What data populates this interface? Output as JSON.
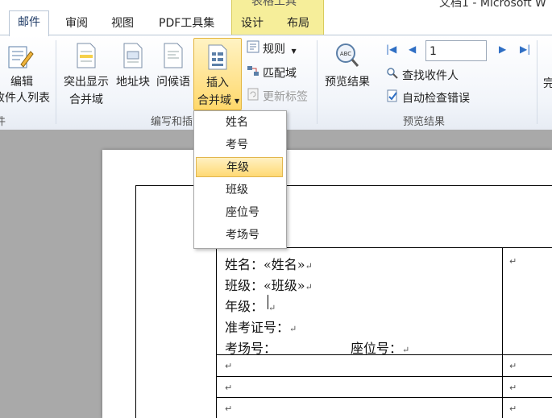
{
  "window": {
    "title": "文档1 - Microsoft W"
  },
  "contextual_tab_group": {
    "label": "表格工具"
  },
  "tabs": [
    {
      "label": "邮件",
      "active": true
    },
    {
      "label": "审阅"
    },
    {
      "label": "视图"
    },
    {
      "label": "PDF工具集"
    },
    {
      "label": "设计"
    },
    {
      "label": "布局"
    }
  ],
  "ribbon": {
    "edit_recipients": {
      "line1": "编辑",
      "line2": "收件人列表"
    },
    "left_group_label_fragment": "件",
    "highlight_fields": {
      "line1": "突出显示",
      "line2": "合并域"
    },
    "address_block": "地址块",
    "greeting_line": "问候语",
    "insert_merge_field": {
      "line1": "插入",
      "line2": "合并域"
    },
    "rules": "规则",
    "match_fields": "匹配域",
    "update_labels": "更新标签",
    "write_insert_group_label": "编写和插",
    "preview_results": "预览结果",
    "record_number": "1",
    "find_recipient": "查找收件人",
    "auto_check_errors": "自动检查错误",
    "preview_group_label": "预览结果",
    "finish_fragment": "完"
  },
  "merge_field_menu": {
    "items": [
      "姓名",
      "考号",
      "年级",
      "班级",
      "座位号",
      "考场号"
    ],
    "selected": "年级"
  },
  "document": {
    "line1_label": "姓名：",
    "line1_field": "«姓名»",
    "line2_label": "班级：",
    "line2_field": "«班级»",
    "line3_label": "年级：",
    "line4_label": "准考证号：",
    "line5_label": "考场号：",
    "line5_label2": "座位号：",
    "para_mark": "↵"
  },
  "colors": {
    "accent": "#1f3b66",
    "highlight": "#ffd86b",
    "context_tab": "#f6ee9a"
  }
}
